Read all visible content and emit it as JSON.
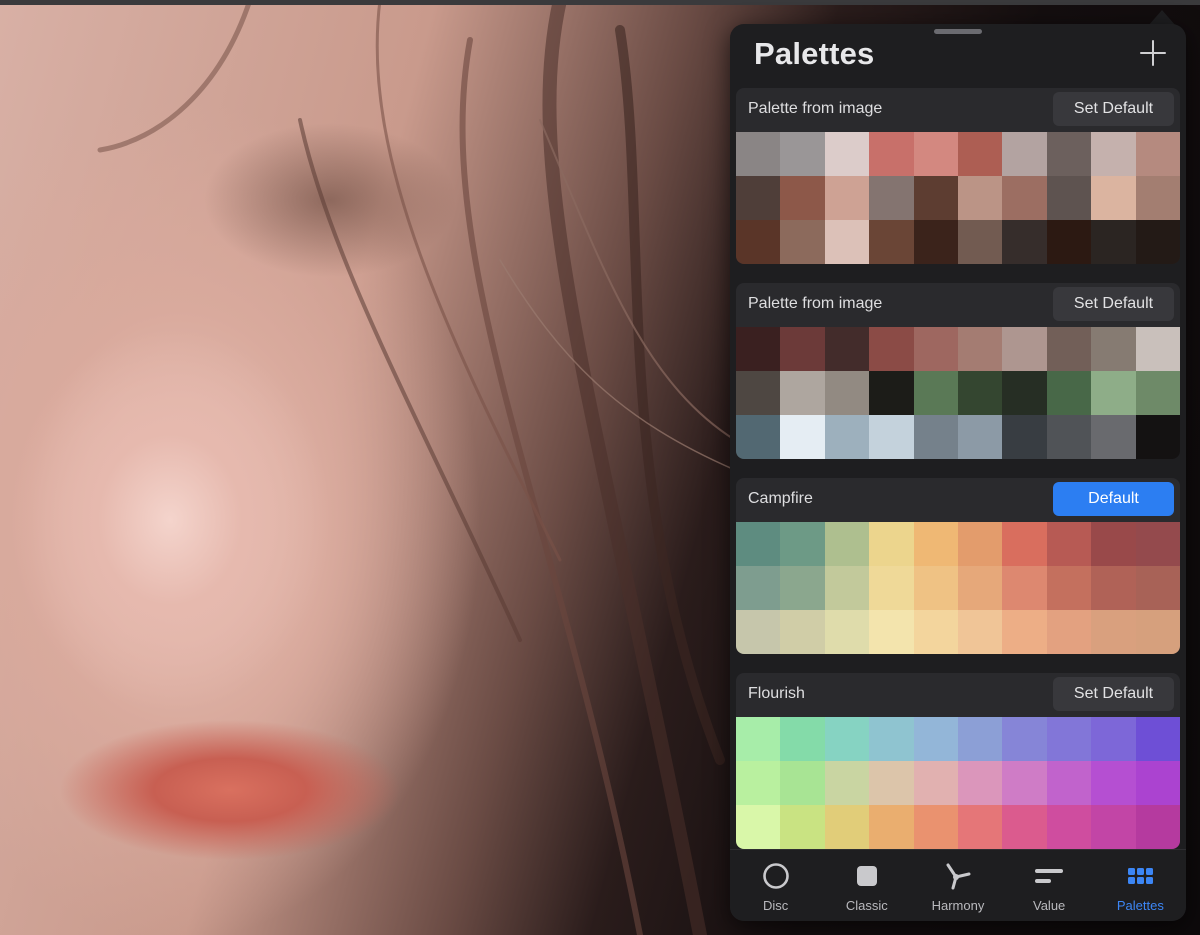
{
  "panel": {
    "title": "Palettes",
    "add_icon": "plus-icon"
  },
  "palettes": [
    {
      "name": "Palette from image",
      "button_label": "Set Default",
      "is_default": false,
      "swatches": [
        "#8a8585",
        "#9a9697",
        "#dcccca",
        "#c8706a",
        "#d38880",
        "#ad5e53",
        "#b3a3a1",
        "#6c605d",
        "#c5b1ad",
        "#b58a7f",
        "#4f3e39",
        "#8d5849",
        "#cea294",
        "#847470",
        "#5d3d31",
        "#bb9486",
        "#9c6e62",
        "#5e5350",
        "#dbb4a0",
        "#a37e71",
        "#5a3528",
        "#8c6a5c",
        "#dcc1b8",
        "#6a4536",
        "#3b231b",
        "#725b51",
        "#362d2b",
        "#2c1912",
        "#2b2522",
        "#231a16"
      ]
    },
    {
      "name": "Palette from image",
      "button_label": "Set Default",
      "is_default": false,
      "swatches": [
        "#3a2020",
        "#6c3a39",
        "#432c2b",
        "#8b4b46",
        "#9e6760",
        "#a47c72",
        "#ae9690",
        "#725f58",
        "#867b72",
        "#c9c0bb",
        "#4e4742",
        "#aea69f",
        "#928a82",
        "#1c1c18",
        "#5a7956",
        "#344630",
        "#262e24",
        "#486848",
        "#8ead88",
        "#6e8a68",
        "#526872",
        "#e5edf3",
        "#9db0bd",
        "#c4d2dc",
        "#75818b",
        "#8c9aa6",
        "#383d42",
        "#505357",
        "#696a6e",
        "#141212"
      ]
    },
    {
      "name": "Campfire",
      "button_label": "Default",
      "is_default": true,
      "swatches": [
        "#5e8c80",
        "#6d9a86",
        "#aebf8f",
        "#ecd58d",
        "#efb874",
        "#e39c6c",
        "#d96e5e",
        "#b75a54",
        "#99494a",
        "#944a4d",
        "#7e9d8f",
        "#8ba78e",
        "#c2c99b",
        "#efd998",
        "#efc284",
        "#e6a87a",
        "#dd8870",
        "#c4705e",
        "#b06257",
        "#a86257",
        "#c6c6ab",
        "#d0cda7",
        "#dfdcab",
        "#f3e4ad",
        "#f3d59d",
        "#f0c597",
        "#edae86",
        "#e3a180",
        "#d9a07e",
        "#d6a07d"
      ]
    },
    {
      "name": "Flourish",
      "button_label": "Set Default",
      "is_default": false,
      "swatches": [
        "#a7eda9",
        "#84dba9",
        "#86d3c2",
        "#8fc4d0",
        "#93b6d8",
        "#8c9fd6",
        "#8685d7",
        "#8276d8",
        "#7d67d8",
        "#6e4fd6",
        "#b9f09f",
        "#a8e494",
        "#c9d5a2",
        "#dcc5aa",
        "#e1b1b0",
        "#db96bb",
        "#cf7cc6",
        "#c163cc",
        "#b54fd2",
        "#ab43d0",
        "#d9f7a9",
        "#c9e382",
        "#e1cd79",
        "#eaae6f",
        "#ea926f",
        "#e57678",
        "#db5b8e",
        "#cf4d9f",
        "#c245a6",
        "#b53a9f"
      ]
    }
  ],
  "tabbar": {
    "tabs": [
      {
        "label": "Disc",
        "icon": "disc-icon",
        "active": false
      },
      {
        "label": "Classic",
        "icon": "classic-square-icon",
        "active": false
      },
      {
        "label": "Harmony",
        "icon": "harmony-icon",
        "active": false
      },
      {
        "label": "Value",
        "icon": "value-sliders-icon",
        "active": false
      },
      {
        "label": "Palettes",
        "icon": "palettes-grid-icon",
        "active": true
      }
    ]
  }
}
